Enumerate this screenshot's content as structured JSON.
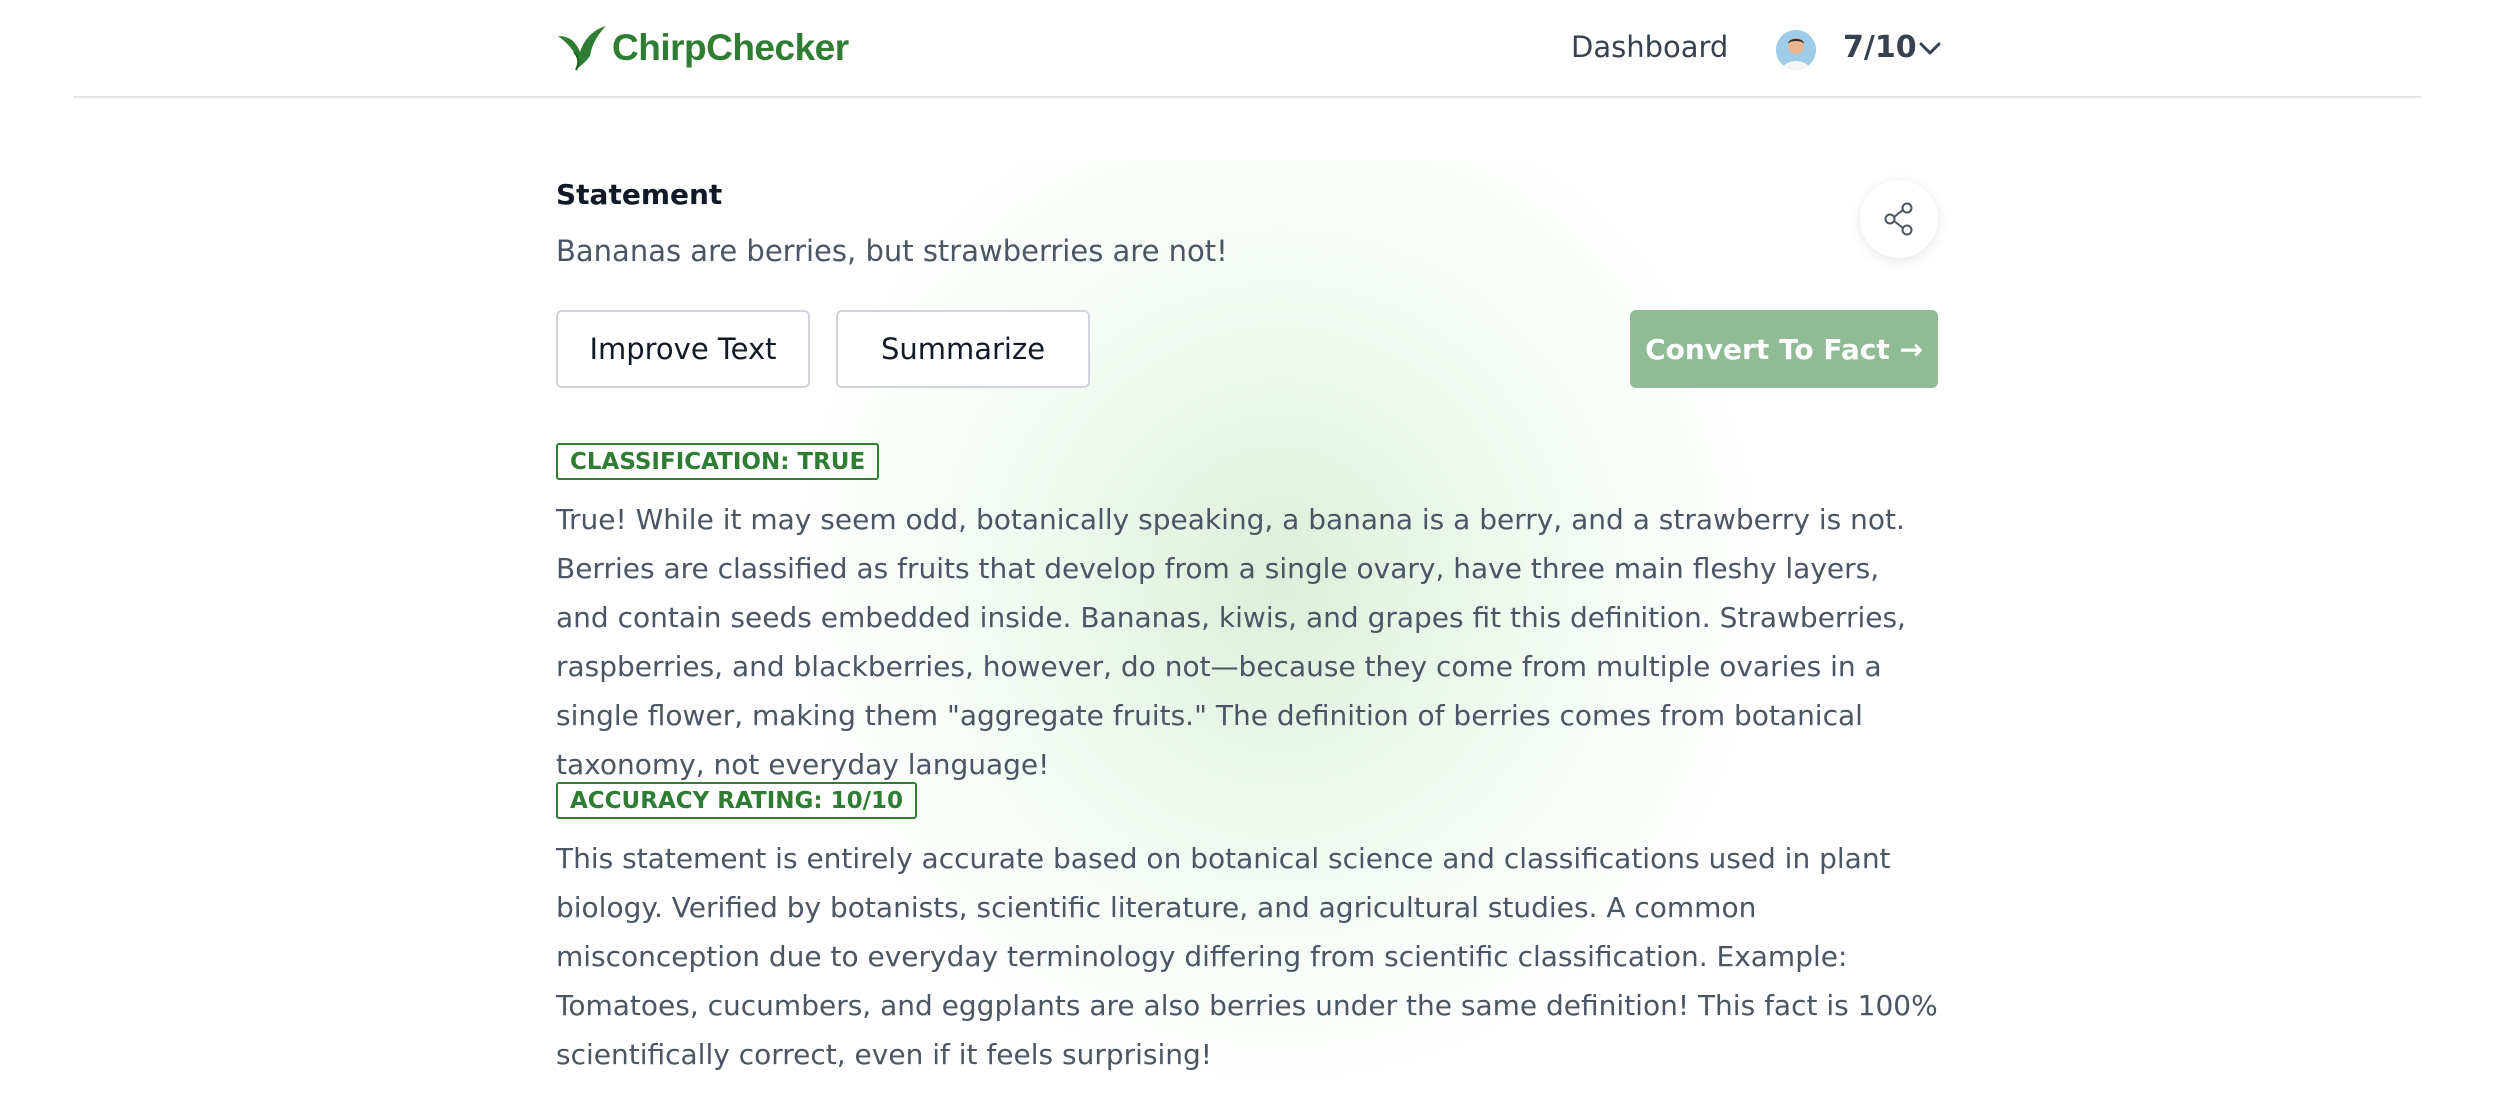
{
  "header": {
    "brand": "ChirpChecker",
    "nav_dashboard": "Dashboard",
    "score": "7/10",
    "icons": [
      "bird-logo-icon",
      "avatar",
      "chevron-down-icon"
    ]
  },
  "statement": {
    "title": "Statement",
    "text": "Bananas are berries, but strawberries are not!"
  },
  "actions": {
    "improve_label": "Improve Text",
    "summarize_label": "Summarize",
    "convert_label": "Convert To Fact →"
  },
  "classification": {
    "badge": "CLASSIFICATION: TRUE",
    "text": "True! While it may seem odd, botanically speaking, a banana is a berry, and a strawberry is not. Berries are classified as fruits that develop from a single ovary, have three main fleshy layers, and contain seeds embedded inside. Bananas, kiwis, and grapes fit this definition. Strawberries, raspberries, and blackberries, however, do not—because they come from multiple ovaries in a single flower, making them \"aggregate fruits.\" The definition of berries comes from botanical taxonomy, not everyday language!"
  },
  "accuracy": {
    "badge": "ACCURACY RATING: 10/10",
    "text": "This statement is entirely accurate based on botanical science and classifications used in plant biology. Verified by botanists, scientific literature, and agricultural studies. A common misconception due to everyday terminology differing from scientific classification. Example: Tomatoes, cucumbers, and eggplants are also berries under the same definition! This fact is 100% scientifically correct, even if it feels surprising!"
  },
  "colors": {
    "brand_green": "#2e7d32",
    "convert_button": "#8fbb95"
  }
}
